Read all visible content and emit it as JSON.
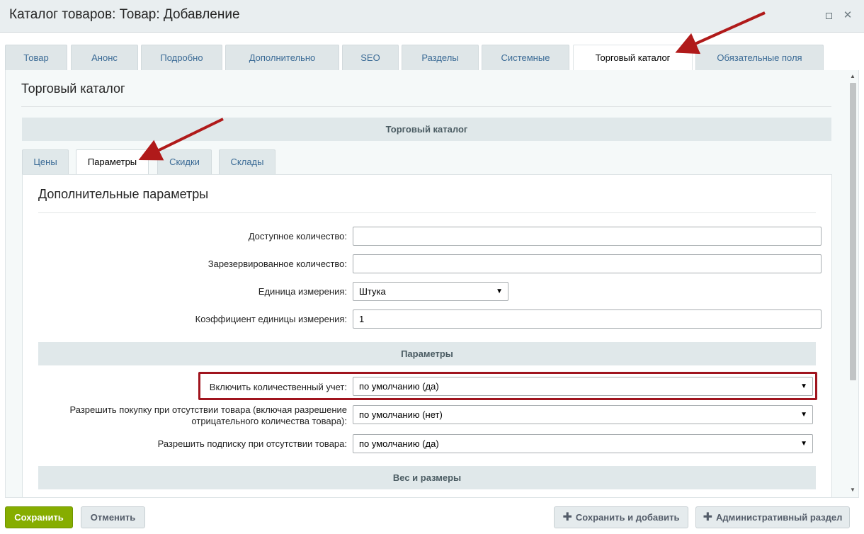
{
  "window": {
    "title": "Каталог товаров: Товар: Добавление"
  },
  "main_tabs": [
    {
      "label": "Товар"
    },
    {
      "label": "Анонс"
    },
    {
      "label": "Подробно"
    },
    {
      "label": "Дополнительно"
    },
    {
      "label": "SEO"
    },
    {
      "label": "Разделы"
    },
    {
      "label": "Системные"
    },
    {
      "label": "Торговый каталог",
      "active": true
    },
    {
      "label": "Обязательные поля"
    }
  ],
  "content": {
    "title": "Торговый каталог",
    "section_header": "Торговый каталог",
    "sub_tabs": [
      {
        "label": "Цены"
      },
      {
        "label": "Параметры",
        "active": true
      },
      {
        "label": "Скидки"
      },
      {
        "label": "Склады"
      }
    ],
    "sub_title": "Дополнительные параметры",
    "fields": {
      "available_qty": {
        "label": "Доступное количество:",
        "value": ""
      },
      "reserved_qty": {
        "label": "Зарезервированное количество:",
        "value": ""
      },
      "unit": {
        "label": "Единица измерения:",
        "value": "Штука"
      },
      "unit_ratio": {
        "label": "Коэффициент единицы измерения:",
        "value": "1"
      }
    },
    "params_header": "Параметры",
    "params": {
      "qty_trace": {
        "label": "Включить количественный учет:",
        "value": "по умолчанию (да)"
      },
      "can_buy_zero": {
        "label_line1": "Разрешить покупку при отсутствии товара (включая разрешение",
        "label_line2": "отрицательного количества товара):",
        "value": "по умолчанию (нет)"
      },
      "subscribe": {
        "label": "Разрешить подписку при отсутствии товара:",
        "value": "по умолчанию (да)"
      }
    },
    "weight_header": "Вес и размеры"
  },
  "buttons": {
    "save": "Сохранить",
    "cancel": "Отменить",
    "save_add": "Сохранить и добавить",
    "admin": "Административный раздел"
  },
  "colors": {
    "accent_green": "#86ad00",
    "highlight_red": "#a0141e",
    "link_blue": "#3b6b96"
  },
  "icons": [
    "maximize-icon",
    "close-icon",
    "dropdown-arrow-icon",
    "plus-icon",
    "annotation-arrow"
  ]
}
